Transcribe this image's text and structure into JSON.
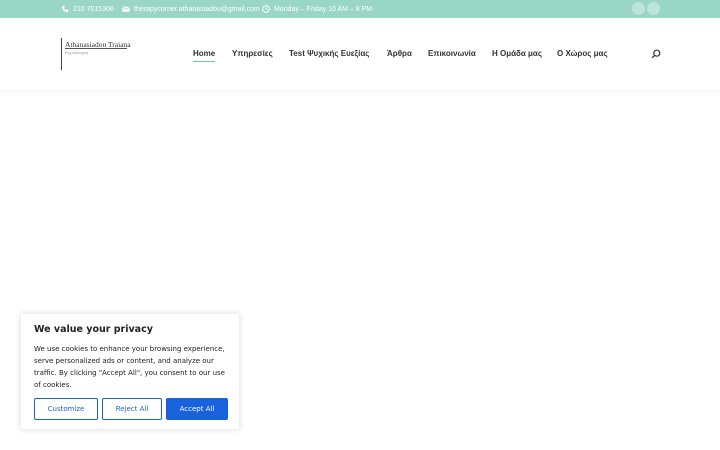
{
  "topbar": {
    "phone": "210 7015306",
    "email": "therapycorner.athanasiadou@gmail.com",
    "hours": "Monday – Friday 10 AM – 8 PM",
    "phone_icon": "phone-icon",
    "email_icon": "mail-icon",
    "hours_icon": "clock-icon",
    "socials": [
      "facebook-icon",
      "instagram-icon"
    ],
    "colors": {
      "background": "#9ad6c4",
      "text": "#ffffff"
    }
  },
  "logo": {
    "name": "Athanasiadou Traiana",
    "subtitle": "Psychologist"
  },
  "nav": {
    "items": [
      {
        "label": "Home",
        "active": true
      },
      {
        "label": "Υπηρεσίες",
        "active": false
      },
      {
        "label": "Test Ψυχικής Ευεξίας",
        "active": false
      },
      {
        "label": "Άρθρα",
        "active": false
      },
      {
        "label": "Επικοινωνία",
        "active": false
      },
      {
        "label": "Η Ομάδα μας",
        "active": false
      },
      {
        "label": "Ο Χώρος μας",
        "active": false
      }
    ],
    "search_icon": "search-icon",
    "accent": "#6ec7ad"
  },
  "cookie_banner": {
    "title": "We value your privacy",
    "text": "We use cookies to enhance your browsing experience, serve personalized ads or content, and analyze our traffic. By clicking \"Accept All\", you consent to our use of cookies.",
    "customize_label": "Customize",
    "reject_label": "Reject All",
    "accept_label": "Accept All",
    "accent": "#1863dc"
  }
}
